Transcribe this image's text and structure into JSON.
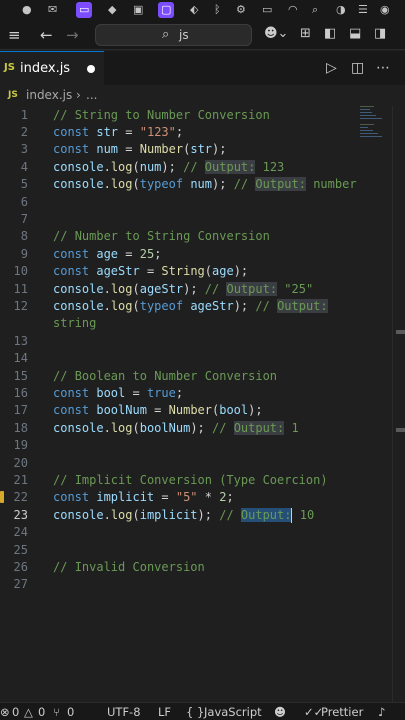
{
  "status_icons": {
    "items": [
      "dot-icon",
      "mail-icon",
      "badge-icon",
      "m-icon",
      "bag-icon",
      "window-icon",
      "tag-icon",
      "bluetooth-icon",
      "gear-icon",
      "wifi-icon",
      "search-icon",
      "switch-icon",
      "control-center-icon"
    ]
  },
  "titlebar": {
    "search_text": "js"
  },
  "tab": {
    "label": "index.js",
    "ext_badge": "JS"
  },
  "breadcrumb": {
    "ext_badge": "JS",
    "file": "index.js",
    "separator": "›",
    "more": "..."
  },
  "editor": {
    "current_line": 23,
    "lines": [
      {
        "n": "1",
        "text": "// String to Number Conversion"
      },
      {
        "n": "2",
        "text": "const str = \"123\";"
      },
      {
        "n": "3",
        "text": "const num = Number(str);"
      },
      {
        "n": "4",
        "text": "console.log(num); // Output: 123"
      },
      {
        "n": "5",
        "text": "console.log(typeof num); // Output: number"
      },
      {
        "n": "6",
        "text": ""
      },
      {
        "n": "7",
        "text": ""
      },
      {
        "n": "8",
        "text": "// Number to String Conversion"
      },
      {
        "n": "9",
        "text": "const age = 25;"
      },
      {
        "n": "10",
        "text": "const ageStr = String(age);"
      },
      {
        "n": "11",
        "text": "console.log(ageStr); // Output: \"25\""
      },
      {
        "n": "12",
        "text": "console.log(typeof ageStr); // Output: string"
      },
      {
        "n": "13",
        "text": ""
      },
      {
        "n": "14",
        "text": ""
      },
      {
        "n": "15",
        "text": "// Boolean to Number Conversion"
      },
      {
        "n": "16",
        "text": "const bool = true;"
      },
      {
        "n": "17",
        "text": "const boolNum = Number(bool);"
      },
      {
        "n": "18",
        "text": "console.log(boolNum); // Output: 1"
      },
      {
        "n": "19",
        "text": ""
      },
      {
        "n": "20",
        "text": ""
      },
      {
        "n": "21",
        "text": "// Implicit Conversion (Type Coercion)"
      },
      {
        "n": "22",
        "text": "const implicit = \"5\" * 2;"
      },
      {
        "n": "23",
        "text": "console.log(implicit); // Output: 10"
      },
      {
        "n": "24",
        "text": ""
      },
      {
        "n": "25",
        "text": ""
      },
      {
        "n": "26",
        "text": "// Invalid Conversion"
      },
      {
        "n": "27",
        "text": ""
      }
    ]
  },
  "statusbar": {
    "errors": "0",
    "warnings": "0",
    "ports": "0",
    "encoding": "UTF-8",
    "eol": "LF",
    "language_braces": "{ }",
    "language": "JavaScript",
    "formatter": "Prettier"
  },
  "colors": {
    "background": "#1f1f1f",
    "comment": "#6a9955",
    "keyword": "#569cd6",
    "variable": "#9cdcfe",
    "function": "#dcdcaa",
    "string": "#ce9178",
    "number": "#b5cea8"
  }
}
